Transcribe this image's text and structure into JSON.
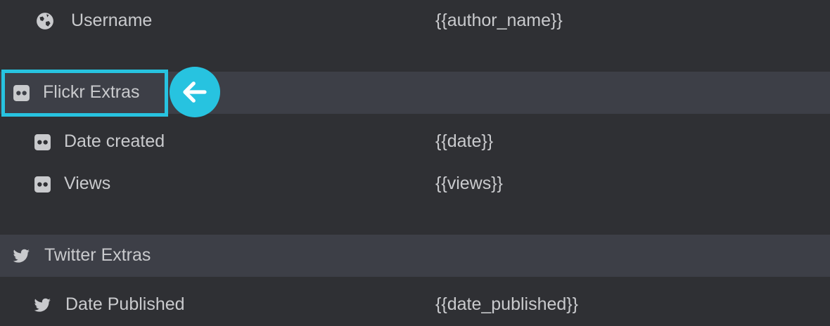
{
  "fields": {
    "username": {
      "label": "Username",
      "value": "{{author_name}}",
      "icon": "globe-icon"
    },
    "flickr": {
      "title": "Flickr Extras",
      "icon": "flickr-icon",
      "items": [
        {
          "label": "Date created",
          "value": "{{date}}",
          "icon": "flickr-icon"
        },
        {
          "label": "Views",
          "value": "{{views}}",
          "icon": "flickr-icon"
        }
      ]
    },
    "twitter": {
      "title": "Twitter Extras",
      "icon": "twitter-icon",
      "items": [
        {
          "label": "Date Published",
          "value": "{{date_published}}",
          "icon": "twitter-icon"
        }
      ]
    }
  },
  "callout": {
    "icon": "arrow-left-icon",
    "color": "#27c3e0"
  },
  "colors": {
    "background": "#2f3034",
    "section_background": "#3d3f47",
    "text": "#c9cacd",
    "accent": "#27c3e0"
  }
}
